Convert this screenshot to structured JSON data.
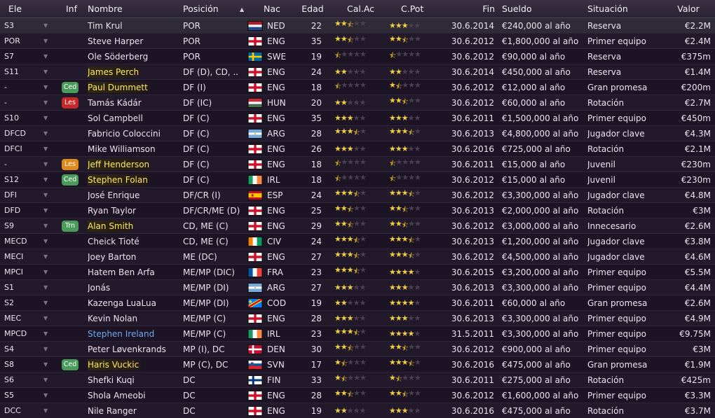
{
  "headers": {
    "pos": "Ele",
    "inf": "Inf",
    "name": "Nombre",
    "posicion": "Posición",
    "sort_icon": "▲",
    "nac": "Nac",
    "edad": "Edad",
    "ca": "Cal.Ac",
    "cp": "C.Pot",
    "fin": "Fin",
    "sueldo": "Sueldo",
    "situacion": "Situación",
    "valor": "Valor"
  },
  "badge_colors": {
    "Ced": "#4a9a5a",
    "Les": "#c82828",
    "Trn": "#4a9a5a",
    "LesO": "#e08a1c"
  },
  "players": [
    {
      "pos": "S3",
      "inf": "",
      "name": "Tim Krul",
      "hl": "",
      "posicion": "POR",
      "flag": "ned",
      "nac": "NED",
      "edad": "22",
      "ca": 2.5,
      "cp": 3,
      "fin": "30.6.2014",
      "sueldo": "€240,000 al año",
      "situacion": "Reserva",
      "valor": "€2.2M"
    },
    {
      "pos": "POR",
      "inf": "",
      "name": "Steve Harper",
      "hl": "",
      "posicion": "POR",
      "flag": "eng",
      "nac": "ENG",
      "edad": "35",
      "ca": 2.5,
      "cp": 2.5,
      "fin": "30.6.2012",
      "sueldo": "€1,800,000 al año",
      "situacion": "Primer equipo",
      "valor": "€2.4M"
    },
    {
      "pos": "S7",
      "inf": "",
      "name": "Ole Söderberg",
      "hl": "",
      "posicion": "POR",
      "flag": "swe",
      "nac": "SWE",
      "edad": "19",
      "ca": 0.5,
      "cp": 0.5,
      "fin": "30.6.2012",
      "sueldo": "€90,000 al año",
      "situacion": "Reserva",
      "valor": "€375m"
    },
    {
      "pos": "S11",
      "inf": "",
      "name": "James Perch",
      "hl": "yellow",
      "posicion": "DF (D), CD, ..",
      "flag": "eng",
      "nac": "ENG",
      "edad": "24",
      "ca": 2,
      "cp": 2,
      "fin": "30.6.2014",
      "sueldo": "€450,000 al año",
      "situacion": "Reserva",
      "valor": "€1.4M"
    },
    {
      "pos": "-",
      "inf": "Ced",
      "name": "Paul Dummett",
      "hl": "yellow",
      "posicion": "DF (I)",
      "flag": "eng",
      "nac": "ENG",
      "edad": "18",
      "ca": 0.5,
      "cp": 1.5,
      "fin": "30.6.2012",
      "sueldo": "€12,000 al año",
      "situacion": "Gran promesa",
      "valor": "€200m"
    },
    {
      "pos": "-",
      "inf": "Les",
      "name": "Tamás Kádár",
      "hl": "",
      "posicion": "DF (IC)",
      "flag": "hun",
      "nac": "HUN",
      "edad": "20",
      "ca": 2,
      "cp": 2.5,
      "fin": "30.6.2012",
      "sueldo": "€60,000 al año",
      "situacion": "Rotación",
      "valor": "€2.7M"
    },
    {
      "pos": "S10",
      "inf": "",
      "name": "Sol Campbell",
      "hl": "",
      "posicion": "DF (C)",
      "flag": "eng",
      "nac": "ENG",
      "edad": "35",
      "ca": 3,
      "cp": 3,
      "fin": "30.6.2011",
      "sueldo": "€1,500,000 al año",
      "situacion": "Primer equipo",
      "valor": "€450m"
    },
    {
      "pos": "DFCD",
      "inf": "",
      "name": "Fabricio Coloccini",
      "hl": "",
      "posicion": "DF (C)",
      "flag": "arg",
      "nac": "ARG",
      "edad": "28",
      "ca": 3.5,
      "cp": 3.5,
      "fin": "30.6.2013",
      "sueldo": "€4,800,000 al año",
      "situacion": "Jugador clave",
      "valor": "€4.3M"
    },
    {
      "pos": "DFCI",
      "inf": "",
      "name": "Mike Williamson",
      "hl": "",
      "posicion": "DF (C)",
      "flag": "eng",
      "nac": "ENG",
      "edad": "26",
      "ca": 3,
      "cp": 3,
      "fin": "30.6.2016",
      "sueldo": "€725,000 al año",
      "situacion": "Rotación",
      "valor": "€2.1M"
    },
    {
      "pos": "-",
      "inf": "LesO",
      "name": "Jeff Henderson",
      "hl": "yellow",
      "posicion": "DF (C)",
      "flag": "eng",
      "nac": "ENG",
      "edad": "18",
      "ca": 0.5,
      "cp": 0.5,
      "fin": "30.6.2011",
      "sueldo": "€15,000 al año",
      "situacion": "Juvenil",
      "valor": "€230m"
    },
    {
      "pos": "S12",
      "inf": "Ced",
      "name": "Stephen Folan",
      "hl": "yellow",
      "posicion": "DF (C)",
      "flag": "irl",
      "nac": "IRL",
      "edad": "18",
      "ca": 0.5,
      "cp": 0.5,
      "fin": "30.6.2012",
      "sueldo": "€15,000 al año",
      "situacion": "Juvenil",
      "valor": "€230m"
    },
    {
      "pos": "DFI",
      "inf": "",
      "name": "José Enrique",
      "hl": "",
      "posicion": "DF/CR (I)",
      "flag": "esp",
      "nac": "ESP",
      "edad": "24",
      "ca": 3.5,
      "cp": 3.5,
      "fin": "30.6.2012",
      "sueldo": "€3,300,000 al año",
      "situacion": "Jugador clave",
      "valor": "€4.8M"
    },
    {
      "pos": "DFD",
      "inf": "",
      "name": "Ryan Taylor",
      "hl": "",
      "posicion": "DF/CR/ME (D)",
      "flag": "eng",
      "nac": "ENG",
      "edad": "25",
      "ca": 2.5,
      "cp": 2.5,
      "fin": "30.6.2013",
      "sueldo": "€2,000,000 al año",
      "situacion": "Rotación",
      "valor": "€3M"
    },
    {
      "pos": "S9",
      "inf": "Trn",
      "name": "Alan Smith",
      "hl": "yellow",
      "posicion": "CD, ME (C)",
      "flag": "eng",
      "nac": "ENG",
      "edad": "29",
      "ca": 2.5,
      "cp": 2.5,
      "fin": "30.6.2012",
      "sueldo": "€3,000,000 al año",
      "situacion": "Innecesario",
      "valor": "€2.6M"
    },
    {
      "pos": "MECD",
      "inf": "",
      "name": "Cheick Tioté",
      "hl": "",
      "posicion": "CD, ME (C)",
      "flag": "civ",
      "nac": "CIV",
      "edad": "24",
      "ca": 3.5,
      "cp": 3.5,
      "fin": "30.6.2013",
      "sueldo": "€1,200,000 al año",
      "situacion": "Jugador clave",
      "valor": "€3.8M"
    },
    {
      "pos": "MECI",
      "inf": "",
      "name": "Joey Barton",
      "hl": "",
      "posicion": "ME (DC)",
      "flag": "eng",
      "nac": "ENG",
      "edad": "27",
      "ca": 3.5,
      "cp": 3.5,
      "fin": "30.6.2012",
      "sueldo": "€4,500,000 al año",
      "situacion": "Jugador clave",
      "valor": "€4.6M"
    },
    {
      "pos": "MPCI",
      "inf": "",
      "name": "Hatem Ben Arfa",
      "hl": "",
      "posicion": "ME/MP (DIC)",
      "flag": "fra",
      "nac": "FRA",
      "edad": "23",
      "ca": 3.5,
      "cp": 4,
      "fin": "30.6.2015",
      "sueldo": "€3,200,000 al año",
      "situacion": "Primer equipo",
      "valor": "€5.5M"
    },
    {
      "pos": "S1",
      "inf": "",
      "name": "Jonás",
      "hl": "",
      "posicion": "ME/MP (DI)",
      "flag": "arg",
      "nac": "ARG",
      "edad": "27",
      "ca": 3,
      "cp": 3,
      "fin": "30.6.2013",
      "sueldo": "€3,300,000 al año",
      "situacion": "Primer equipo",
      "valor": "€4.4M"
    },
    {
      "pos": "S2",
      "inf": "",
      "name": "Kazenga LuaLua",
      "hl": "",
      "posicion": "ME/MP (DI)",
      "flag": "cod",
      "nac": "COD",
      "edad": "19",
      "ca": 2,
      "cp": 4,
      "fin": "30.6.2011",
      "sueldo": "€60,000 al año",
      "situacion": "Gran promesa",
      "valor": "€2.6M"
    },
    {
      "pos": "MEC",
      "inf": "",
      "name": "Kevin Nolan",
      "hl": "",
      "posicion": "ME/MP (C)",
      "flag": "eng",
      "nac": "ENG",
      "edad": "28",
      "ca": 3,
      "cp": 3,
      "fin": "30.6.2013",
      "sueldo": "€3,300,000 al año",
      "situacion": "Primer equipo",
      "valor": "€4.9M"
    },
    {
      "pos": "MPCD",
      "inf": "",
      "name": "Stephen Ireland",
      "hl": "blue",
      "posicion": "ME/MP (C)",
      "flag": "irl",
      "nac": "IRL",
      "edad": "23",
      "ca": 3.5,
      "cp": 4,
      "fin": "31.5.2011",
      "sueldo": "€3,300,000 al año",
      "situacion": "Primer equipo",
      "valor": "€9.75M"
    },
    {
      "pos": "S4",
      "inf": "",
      "name": "Peter Løvenkrands",
      "hl": "",
      "posicion": "MP (I), DC",
      "flag": "den",
      "nac": "DEN",
      "edad": "30",
      "ca": 2.5,
      "cp": 2.5,
      "fin": "30.6.2012",
      "sueldo": "€900,000 al año",
      "situacion": "Primer equipo",
      "valor": "€3M"
    },
    {
      "pos": "S8",
      "inf": "Ced",
      "name": "Haris Vuckic",
      "hl": "yellow",
      "posicion": "MP (C), DC",
      "flag": "svn",
      "nac": "SVN",
      "edad": "17",
      "ca": 1.5,
      "cp": 3.5,
      "fin": "30.6.2016",
      "sueldo": "€475,000 al año",
      "situacion": "Gran promesa",
      "valor": "€1.9M"
    },
    {
      "pos": "S6",
      "inf": "",
      "name": "Shefki Kuqi",
      "hl": "",
      "posicion": "DC",
      "flag": "fin",
      "nac": "FIN",
      "edad": "33",
      "ca": 1.5,
      "cp": 1.5,
      "fin": "30.6.2011",
      "sueldo": "€275,000 al año",
      "situacion": "Rotación",
      "valor": "€425m"
    },
    {
      "pos": "S5",
      "inf": "",
      "name": "Shola Ameobi",
      "hl": "",
      "posicion": "DC",
      "flag": "eng",
      "nac": "ENG",
      "edad": "28",
      "ca": 2.5,
      "cp": 2.5,
      "fin": "30.6.2012",
      "sueldo": "€1,600,000 al año",
      "situacion": "Primer equipo",
      "valor": "€3.3M"
    },
    {
      "pos": "DCC",
      "inf": "",
      "name": "Nile Ranger",
      "hl": "",
      "posicion": "DC",
      "flag": "eng",
      "nac": "ENG",
      "edad": "19",
      "ca": 2,
      "cp": 3,
      "fin": "30.6.2016",
      "sueldo": "€475,000 al año",
      "situacion": "Rotación",
      "valor": "€3.7M"
    }
  ]
}
